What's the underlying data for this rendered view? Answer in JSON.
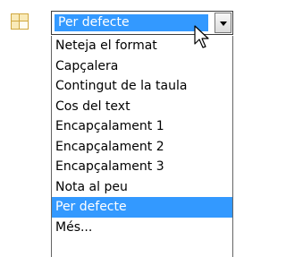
{
  "style_selector": {
    "icon": "style-table-icon",
    "current_value": "Per defecte",
    "arrow_icon": "chevron-down-icon"
  },
  "dropdown": {
    "items": [
      "Neteja el format",
      "Capçalera",
      "Contingut de la taula",
      "Cos del text",
      "Encapçalament 1",
      "Encapçalament 2",
      "Encapçalament 3",
      "Nota al peu",
      "Per defecte",
      "Més..."
    ],
    "selected_index": 8
  },
  "colors": {
    "selection": "#3399ff",
    "selection_text": "#ffffff"
  }
}
